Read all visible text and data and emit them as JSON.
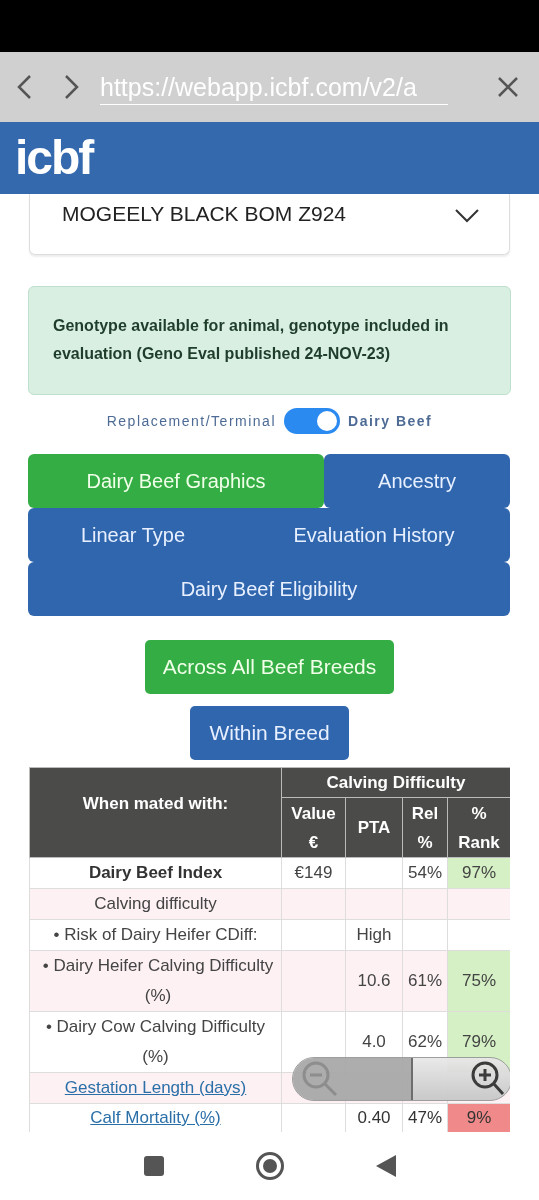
{
  "browser": {
    "url": "https://webapp.icbf.com/v2/a"
  },
  "header": {
    "logo": "icbf"
  },
  "animal_select": {
    "value": "MOGEELY BLACK BOM Z924"
  },
  "notice": "Genotype available for animal, genotype included in evaluation (Geno Eval published 24-NOV-23)",
  "toggle": {
    "left_label": "Replacement/Terminal",
    "right_label": "Dairy Beef",
    "on": true
  },
  "tabs": [
    {
      "label": "Dairy Beef Graphics",
      "selected": true
    },
    {
      "label": "Ancestry",
      "selected": false
    },
    {
      "label": "Linear Type",
      "selected": false
    },
    {
      "label": "Evaluation History",
      "selected": false
    },
    {
      "label": "Dairy Beef Eligibility",
      "selected": false
    }
  ],
  "breed_buttons": [
    {
      "label": "Across All Beef Breeds",
      "selected": true
    },
    {
      "label": "Within Breed",
      "selected": false
    }
  ],
  "table": {
    "group_heading": "Calving Difficulty",
    "row_heading": "When mated with:",
    "columns": [
      "Value €",
      "PTA",
      "Rel %",
      "% Rank"
    ],
    "rows": [
      {
        "kind": "index",
        "label": "Dairy Beef Index",
        "value": "€149",
        "pta": "",
        "rel": "54%",
        "rank": "97%",
        "color": "#d4f0c4"
      },
      {
        "kind": "heading",
        "label": "Calving difficulty",
        "value": "",
        "pta": "",
        "rel": "",
        "rank": ""
      },
      {
        "kind": "item",
        "label": "• Risk of Dairy Heifer CDiff:",
        "value": "",
        "pta": "High",
        "rel": "",
        "rank": ""
      },
      {
        "kind": "item",
        "label": "• Dairy Heifer Calving Difficulty (%)",
        "value": "",
        "pta": "10.6",
        "rel": "61%",
        "rank": "75%",
        "color": "#d4f0c4"
      },
      {
        "kind": "item",
        "label": "• Dairy Cow Calving Difficulty (%)",
        "value": "",
        "pta": "4.0",
        "rel": "62%",
        "rank": "79%",
        "color": "#d4f0c4"
      },
      {
        "kind": "link",
        "label": "Gestation Length (days)",
        "value": "",
        "pta": "",
        "rel": "",
        "rank": ""
      },
      {
        "kind": "link",
        "label": "Calf Mortality (%)",
        "value": "",
        "pta": "0.40",
        "rel": "47%",
        "rank": "9%",
        "color": "#f08a8a"
      }
    ]
  }
}
